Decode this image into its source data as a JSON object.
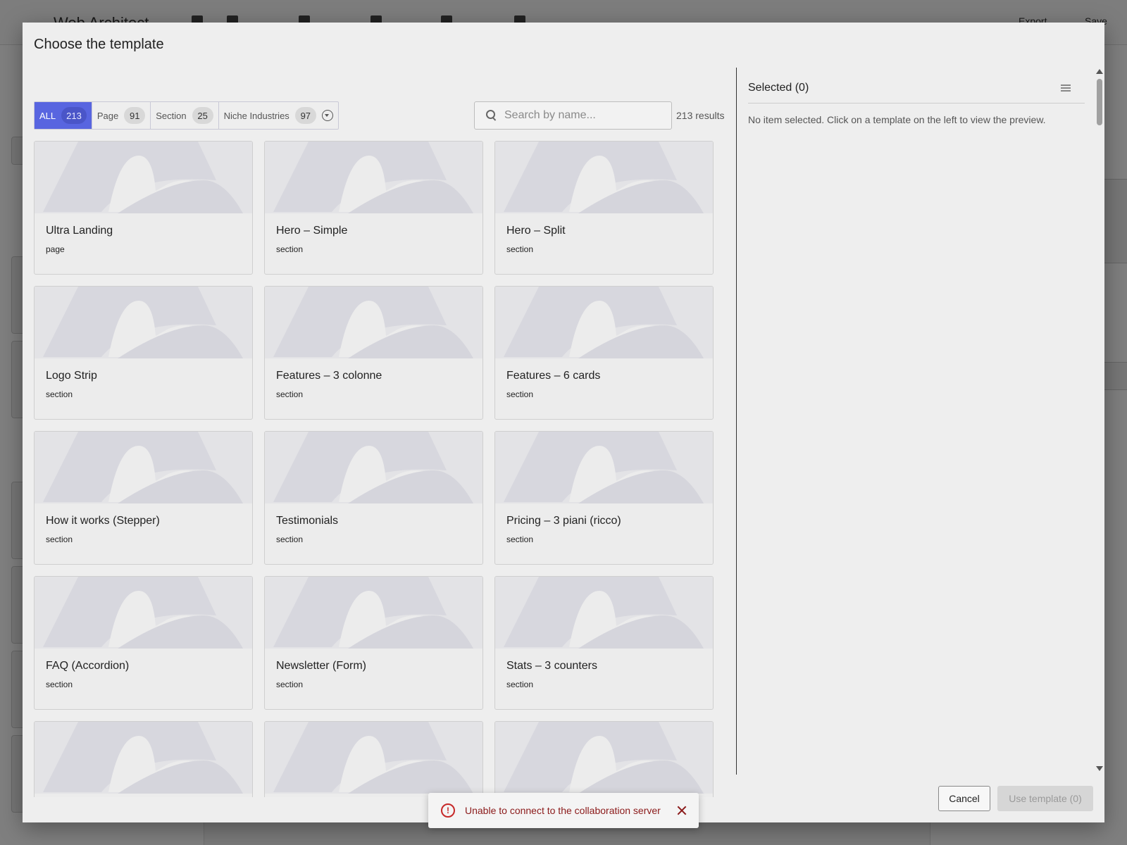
{
  "background": {
    "app_title": "Web Architect",
    "export_label": "Export",
    "save_label": "Save"
  },
  "modal": {
    "title": "Choose the template",
    "filters": [
      {
        "label": "ALL",
        "count": "213",
        "active": true
      },
      {
        "label": "Page",
        "count": "91"
      },
      {
        "label": "Section",
        "count": "25"
      },
      {
        "label": "Niche Industries",
        "count": "97"
      }
    ],
    "filter_dropdown_icon": "chevron-circle-down-icon",
    "search": {
      "placeholder": "Search by name...",
      "value": ""
    },
    "results_count": "213 results",
    "templates": [
      {
        "name": "Ultra Landing",
        "type": "page"
      },
      {
        "name": "Hero – Simple",
        "type": "section"
      },
      {
        "name": "Hero – Split",
        "type": "section"
      },
      {
        "name": "Logo Strip",
        "type": "section"
      },
      {
        "name": "Features – 3 colonne",
        "type": "section"
      },
      {
        "name": "Features – 6 cards",
        "type": "section"
      },
      {
        "name": "How it works (Stepper)",
        "type": "section"
      },
      {
        "name": "Testimonials",
        "type": "section"
      },
      {
        "name": "Pricing – 3 piani (ricco)",
        "type": "section"
      },
      {
        "name": "FAQ (Accordion)",
        "type": "section"
      },
      {
        "name": "Newsletter (Form)",
        "type": "section"
      },
      {
        "name": "Stats – 3 counters",
        "type": "section"
      },
      {
        "name": "",
        "type": ""
      },
      {
        "name": "",
        "type": ""
      },
      {
        "name": "",
        "type": ""
      }
    ],
    "selected": {
      "title": "Selected (0)",
      "empty_message": "No item selected. Click on a template on the left to view the preview."
    },
    "buttons": {
      "cancel": "Cancel",
      "use_template": "Use template (0)"
    }
  },
  "toast": {
    "message": "Unable to connect to the collaboration server",
    "icon": "error-icon"
  },
  "colors": {
    "accent": "#5865e0",
    "error": "#c62828"
  }
}
